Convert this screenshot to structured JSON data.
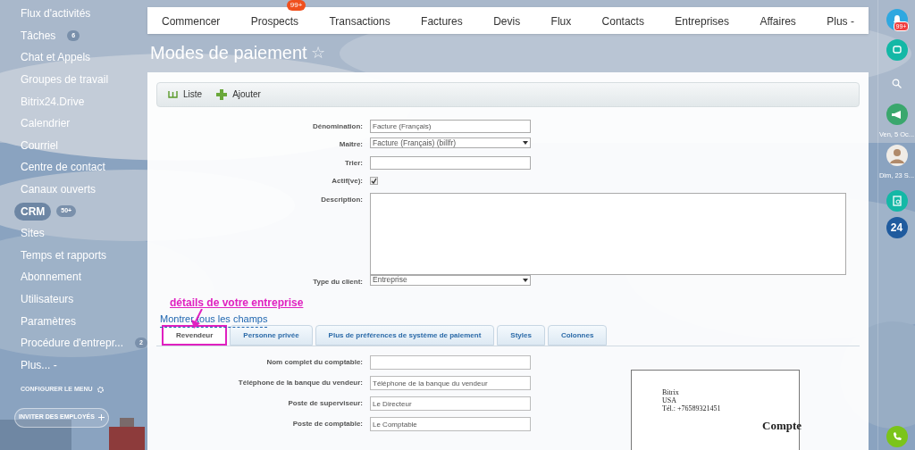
{
  "sidebar": {
    "items": [
      {
        "label": "Flux d'activités",
        "selected": false
      },
      {
        "label": "Tâches",
        "counter": "6",
        "selected": false
      },
      {
        "label": "Chat et Appels",
        "selected": false
      },
      {
        "label": "Groupes de travail",
        "selected": false
      },
      {
        "label": "Bitrix24.Drive",
        "selected": false
      },
      {
        "label": "Calendrier",
        "selected": false
      },
      {
        "label": "Courriel",
        "selected": false
      },
      {
        "label": "Centre de contact",
        "selected": false
      },
      {
        "label": "Canaux ouverts",
        "selected": false
      },
      {
        "label": "CRM",
        "counter": "50+",
        "selected": true
      },
      {
        "label": "Sites",
        "selected": false
      },
      {
        "label": "Temps et rapports",
        "selected": false
      },
      {
        "label": "Abonnement",
        "selected": false
      },
      {
        "label": "Utilisateurs",
        "selected": false
      },
      {
        "label": "Paramètres",
        "selected": false
      },
      {
        "label": "Procédure d'entrepr...",
        "counter": "2",
        "selected": false
      },
      {
        "label": "Plus... -",
        "selected": false
      }
    ],
    "configure": "CONFIGURER LE MENU",
    "invite": "INVITER DES EMPLOYÉS"
  },
  "top_nav": [
    {
      "label": "Commencer"
    },
    {
      "label": "Prospects",
      "badge": "99+"
    },
    {
      "label": "Transactions"
    },
    {
      "label": "Factures"
    },
    {
      "label": "Devis"
    },
    {
      "label": "Flux"
    },
    {
      "label": "Contacts"
    },
    {
      "label": "Entreprises"
    },
    {
      "label": "Affaires"
    },
    {
      "label": "Plus -"
    }
  ],
  "page_title": "Modes de paiement",
  "favorite_star": "☆",
  "toolbar": [
    {
      "label": "Liste",
      "kind": "list"
    },
    {
      "label": "Ajouter",
      "kind": "add"
    }
  ],
  "form": [
    {
      "label": "Dénomination:",
      "kind": "text",
      "value": "Facture (Français)"
    },
    {
      "label": "Maître:",
      "kind": "select",
      "value": "Facture (Français) (billfr)"
    },
    {
      "label": "Trier:",
      "kind": "text"
    },
    {
      "label": "Actif(ve):",
      "kind": "checkbox",
      "checked": true
    },
    {
      "label": "Description:",
      "kind": "textarea"
    },
    {
      "label": "Type du client:",
      "kind": "select",
      "value": "Entreprise"
    }
  ],
  "annotation": "détails de votre entreprise",
  "show_all_link": "Montrer tous les champs",
  "tabs": [
    {
      "label": "Revendeur",
      "selected": true
    },
    {
      "label": "Personne privée",
      "selected": false
    },
    {
      "label": "Plus de préférences de système de paiement",
      "selected": false
    },
    {
      "label": "Styles",
      "selected": false
    },
    {
      "label": "Colonnes",
      "selected": false
    }
  ],
  "seller_fields": [
    {
      "label": "Nom complet du comptable:"
    },
    {
      "label": "Téléphone de la banque du vendeur:",
      "placeholder": "Téléphone de la banque du vendeur"
    },
    {
      "label": "Poste de superviseur:",
      "value": "Le Directeur"
    },
    {
      "label": "Poste de comptable:",
      "value": "Le Comptable"
    }
  ],
  "preview": {
    "lines": [
      "Bitrix",
      "USA",
      "Tél.: +76589321451"
    ],
    "heading": "Compte"
  },
  "right_bar": {
    "notifications_badge": "99+",
    "dates": [
      "Ven, 5 Oc...",
      "Dim, 23 S..."
    ],
    "logo": "24"
  }
}
